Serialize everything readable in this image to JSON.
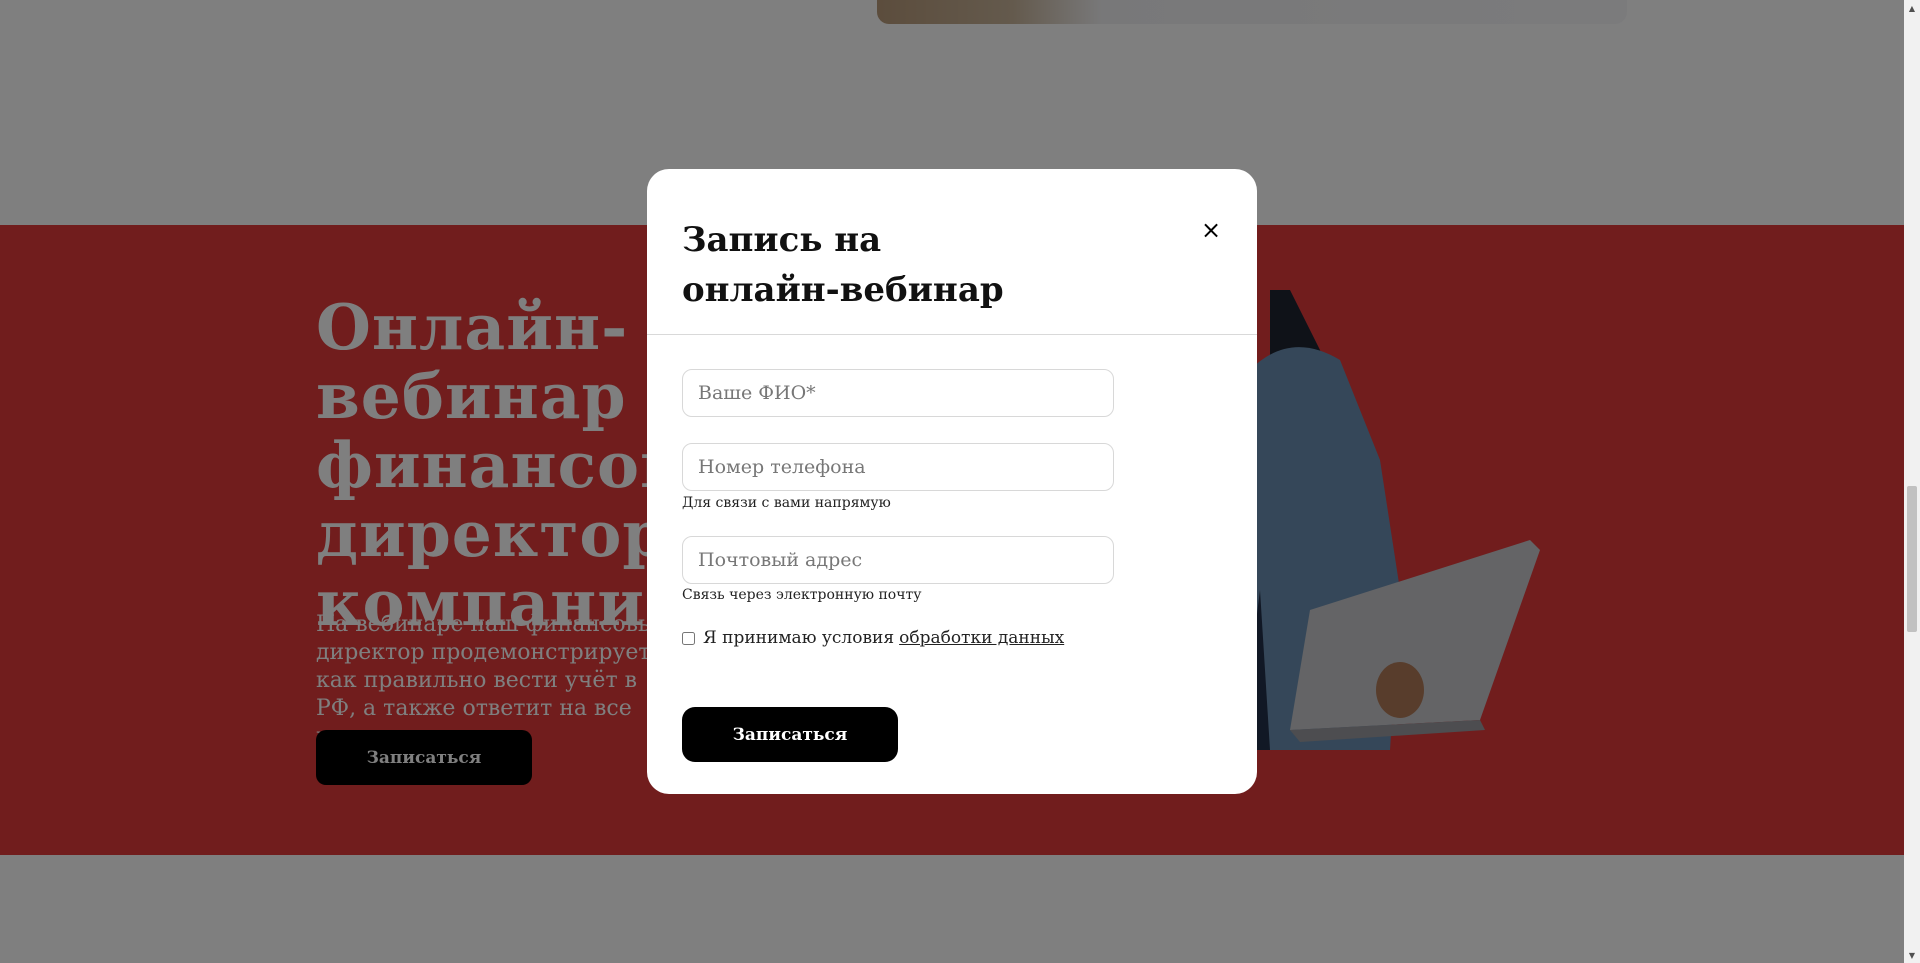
{
  "hero": {
    "title": "Онлайн-вебинар с финансовым директором компании",
    "text": "На вебинаре наш финансовый директор продемонстрирует как правильно вести учёт в РФ, а также ответит на все вопросы",
    "button_label": "Записаться"
  },
  "modal": {
    "title": "Запись на онлайн-вебинар",
    "close_icon": "×",
    "fields": {
      "name_placeholder": "Ваше ФИО*",
      "phone_placeholder": "Номер телефона",
      "phone_hint": "Для связи с вами напрямую",
      "email_placeholder": "Почтовый адрес",
      "email_hint": "Связь через электронную почту"
    },
    "consent": {
      "text": "Я принимаю условия",
      "link": "обработки данных"
    },
    "submit_label": "Записаться"
  },
  "colors": {
    "section_red": "#e23a3a",
    "overlay": "rgba(0,0,0,0.5)",
    "button": "#000000"
  }
}
